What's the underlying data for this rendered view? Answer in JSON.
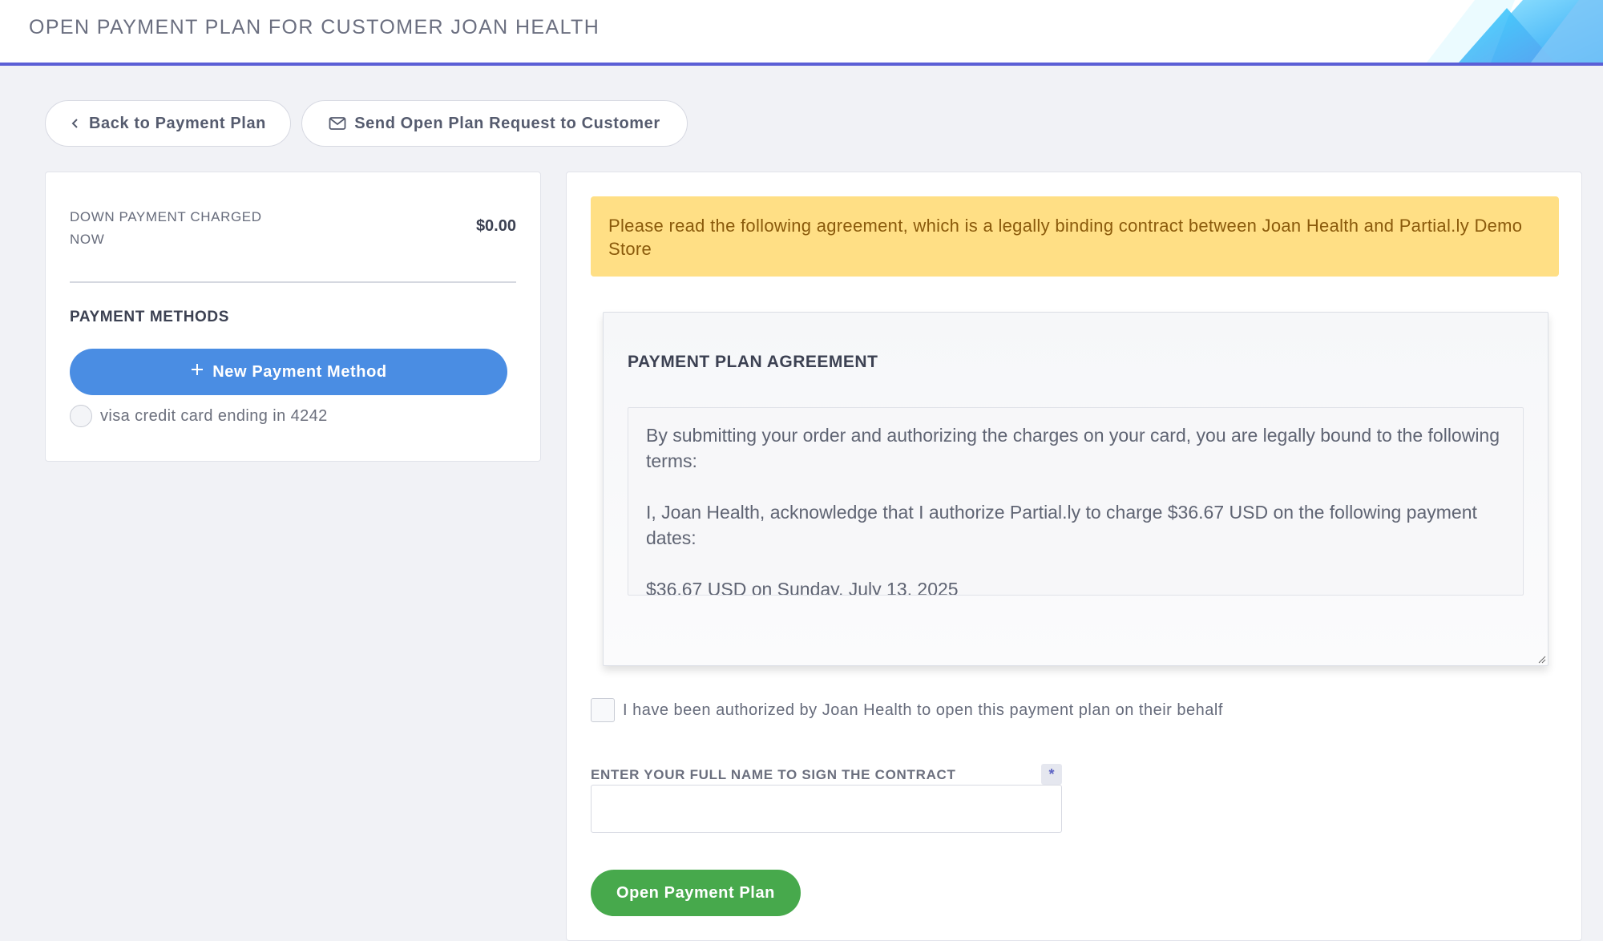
{
  "header": {
    "title": "OPEN PAYMENT PLAN FOR CUSTOMER JOAN HEALTH"
  },
  "actions": {
    "back_label": "Back to Payment Plan",
    "send_label": "Send Open Plan Request to Customer"
  },
  "summary": {
    "down_payment_label": "DOWN PAYMENT CHARGED NOW",
    "down_payment_value": "$0.00"
  },
  "payment_methods": {
    "title": "PAYMENT METHODS",
    "new_button_label": "New Payment Method",
    "options": [
      {
        "label": "visa credit card ending in 4242"
      }
    ]
  },
  "agreement": {
    "notice": "Please read the following agreement, which is a legally binding contract between Joan Health and Partial.ly Demo Store",
    "title": "PAYMENT PLAN AGREEMENT",
    "paragraphs": [
      "By submitting your order and authorizing the charges on your card, you are legally bound to the following terms:",
      "I, Joan Health, acknowledge that I authorize Partial.ly to charge $36.67 USD on the following payment dates:",
      "$36.67 USD on Sunday, July 13, 2025"
    ]
  },
  "authorization": {
    "checkbox_label": "I have been authorized by Joan Health to open this payment plan on their behalf"
  },
  "signature": {
    "label": "ENTER YOUR FULL NAME TO SIGN THE CONTRACT",
    "required_marker": "*",
    "value": "",
    "placeholder": ""
  },
  "submit": {
    "label": "Open Payment Plan"
  },
  "colors": {
    "accent": "#5b5fd6",
    "primary_button": "#4a8de3",
    "success_button": "#47a94c",
    "warning_bg": "#ffdf85",
    "warning_text": "#8a5a0b"
  },
  "icons": {
    "back": "chevron-left-icon",
    "send": "envelope-icon",
    "new": "plus-icon"
  }
}
